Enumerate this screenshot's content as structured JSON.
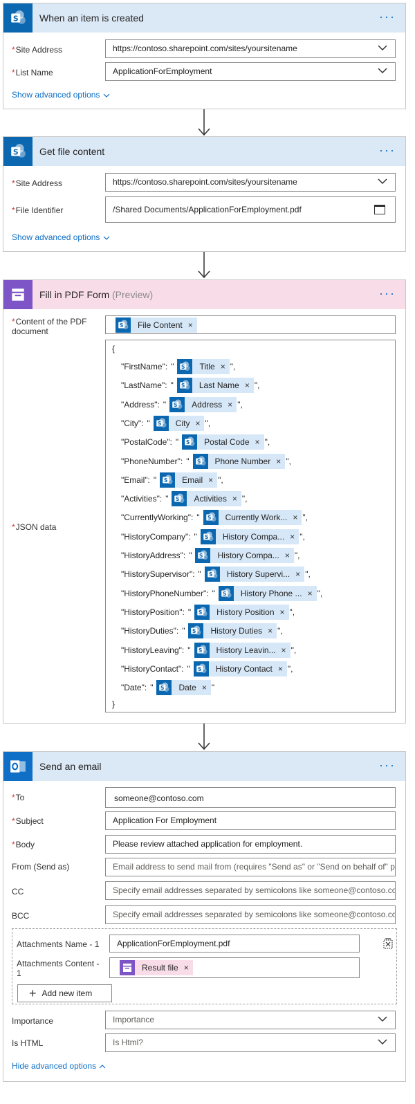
{
  "colors": {
    "sharepoint_blue": "#0b67b0",
    "pdf_purple": "#7d55c7",
    "header_blue": "#dbe8f6",
    "header_pink": "#f8dde9",
    "token_blue": "#d6e7f7",
    "link_blue": "#0f6fc6",
    "required_red": "#d13438"
  },
  "step1": {
    "title": "When an item is created",
    "icon": "sharepoint-icon",
    "site_label": "Site Address",
    "site_value": "https://contoso.sharepoint.com/sites/yoursitename",
    "list_label": "List Name",
    "list_value": "ApplicationForEmployment",
    "advanced": "Show advanced options"
  },
  "step2": {
    "title": "Get file content",
    "icon": "sharepoint-icon",
    "site_label": "Site Address",
    "site_value": "https://contoso.sharepoint.com/sites/yoursitename",
    "file_label": "File Identifier",
    "file_value": "/Shared Documents/ApplicationForEmployment.pdf",
    "advanced": "Show advanced options"
  },
  "step3": {
    "title": "Fill in PDF Form",
    "preview": "(Preview)",
    "icon": "pdf-form-icon",
    "content_label": "Content of the PDF document",
    "content_token": "File Content",
    "json_label": "JSON data",
    "open_brace": "{",
    "close_brace": "}",
    "json_fields": [
      {
        "key": "\"FirstName\":",
        "token": "Title",
        "suffix": "\","
      },
      {
        "key": "\"LastName\":",
        "token": "Last Name",
        "suffix": "\","
      },
      {
        "key": "\"Address\":",
        "token": "Address",
        "suffix": "\","
      },
      {
        "key": "\"City\":",
        "token": "City",
        "suffix": "\","
      },
      {
        "key": "\"PostalCode\":",
        "token": "Postal Code",
        "suffix": "\","
      },
      {
        "key": "\"PhoneNumber\":",
        "token": "Phone Number",
        "suffix": "\","
      },
      {
        "key": "\"Email\":",
        "token": "Email",
        "suffix": "\","
      },
      {
        "key": "\"Activities\":",
        "token": "Activities",
        "suffix": "\","
      },
      {
        "key": "\"CurrentlyWorking\":",
        "token": "Currently Work...",
        "suffix": "\","
      },
      {
        "key": "\"HistoryCompany\":",
        "token": "History Compa...",
        "suffix": "\","
      },
      {
        "key": "\"HistoryAddress\":",
        "token": "History Compa...",
        "suffix": "\","
      },
      {
        "key": "\"HistorySupervisor\":",
        "token": "History Supervi...",
        "suffix": "\","
      },
      {
        "key": "\"HistoryPhoneNumber\":",
        "token": "History Phone ...",
        "suffix": "\","
      },
      {
        "key": "\"HistoryPosition\":",
        "token": "History Position",
        "suffix": "\","
      },
      {
        "key": "\"HistoryDuties\":",
        "token": "History Duties",
        "suffix": "\","
      },
      {
        "key": "\"HistoryLeaving\":",
        "token": "History Leavin...",
        "suffix": "\","
      },
      {
        "key": "\"HistoryContact\":",
        "token": "History Contact",
        "suffix": "\","
      },
      {
        "key": "\"Date\":",
        "token": "Date",
        "suffix": "\""
      }
    ]
  },
  "step4": {
    "title": "Send an email",
    "icon": "outlook-icon",
    "to_label": "To",
    "to_value": "someone@contoso.com",
    "subject_label": "Subject",
    "subject_value": "Application For Employment",
    "body_label": "Body",
    "body_value": "Please review attached application for employment.",
    "from_label": "From (Send as)",
    "from_placeholder": "Email address to send mail from (requires \"Send as\" or \"Send on behalf of\" pe",
    "cc_label": "CC",
    "cc_placeholder": "Specify email addresses separated by semicolons like someone@contoso.com",
    "bcc_label": "BCC",
    "bcc_placeholder": "Specify email addresses separated by semicolons like someone@contoso.com",
    "att_name_label": "Attachments Name - 1",
    "att_name_value": "ApplicationForEmployment.pdf",
    "att_content_label": "Attachments Content - 1",
    "att_content_token": "Result file",
    "add_item": "Add new item",
    "importance_label": "Importance",
    "importance_placeholder": "Importance",
    "ishtml_label": "Is HTML",
    "ishtml_placeholder": "Is Html?",
    "advanced": "Hide advanced options"
  },
  "menu_dots": "···"
}
